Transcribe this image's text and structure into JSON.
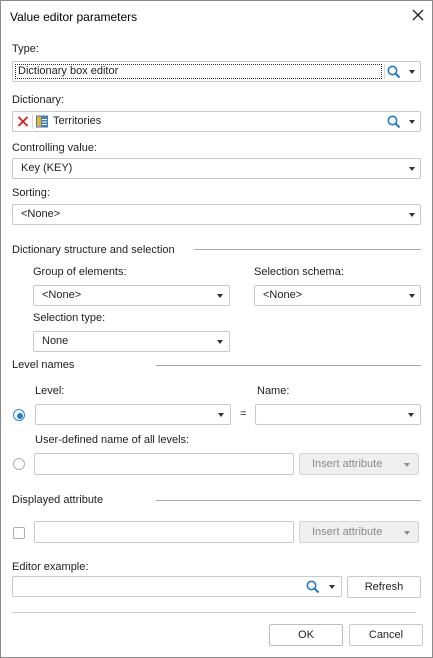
{
  "dialog": {
    "title": "Value editor parameters",
    "icons": {
      "close": "close-icon",
      "search": "search-icon",
      "clear": "clear-x-icon",
      "dictionary": "dictionary-table-icon",
      "dropdown": "chevron-down-icon"
    }
  },
  "type": {
    "label": "Type:",
    "value": "Dictionary box editor"
  },
  "dictionary": {
    "label": "Dictionary:",
    "value": "Territories"
  },
  "controlling": {
    "label": "Controlling value:",
    "value": "Key (KEY)"
  },
  "sorting": {
    "label": "Sorting:",
    "value": "<None>"
  },
  "structure": {
    "heading": "Dictionary structure and selection",
    "group_label": "Group of elements:",
    "group_value": "<None>",
    "schema_label": "Selection schema:",
    "schema_value": "<None>",
    "seltype_label": "Selection type:",
    "seltype_value": "None"
  },
  "levels": {
    "heading": "Level names",
    "level_label": "Level:",
    "level_value": "",
    "equals": "=",
    "name_label": "Name:",
    "name_value": "",
    "all_label": "User-defined name of all levels:",
    "all_value": "",
    "insert_attr": "Insert attribute",
    "specific_selected": true
  },
  "displayed": {
    "heading": "Displayed attribute",
    "value": "",
    "insert_attr": "Insert attribute",
    "checked": false
  },
  "example": {
    "label": "Editor example:",
    "value": "",
    "refresh": "Refresh"
  },
  "footer": {
    "ok": "OK",
    "cancel": "Cancel"
  },
  "colors": {
    "accent": "#1e7ed4",
    "search": "#1f78c8",
    "clear": "#d42020",
    "disabled_bg": "#efefef"
  }
}
